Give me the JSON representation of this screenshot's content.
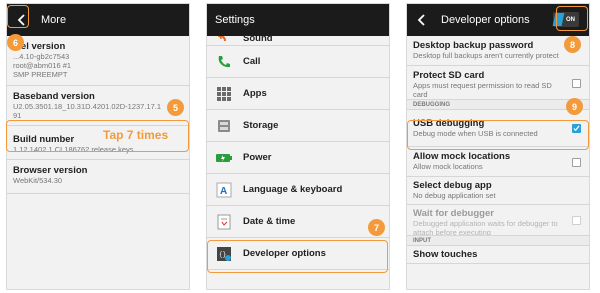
{
  "panel1": {
    "title": "More",
    "items": [
      {
        "title": "...el version",
        "sub": [
          "...4.10-gb2c7543",
          "root@abm016 #1",
          "SMP PREEMPT"
        ]
      },
      {
        "title": "Baseband version",
        "sub": [
          "U2.05.3501.18_10.31D.4201.02D-1237.17.1",
          "91"
        ]
      },
      {
        "title": "Build number",
        "sub": [
          "1.12.1402.1 CL186762 release keys"
        ]
      },
      {
        "title": "Browser version",
        "sub": [
          "WebKit/534.30"
        ]
      }
    ],
    "tap_text": "Tap 7 times"
  },
  "panel2": {
    "title": "Settings",
    "items": [
      {
        "label": "Sound",
        "icon": "sound-icon"
      },
      {
        "label": "Call",
        "icon": "phone-icon"
      },
      {
        "label": "Apps",
        "icon": "apps-grid-icon"
      },
      {
        "label": "Storage",
        "icon": "storage-icon"
      },
      {
        "label": "Power",
        "icon": "battery-icon"
      },
      {
        "label": "Language & keyboard",
        "icon": "language-icon"
      },
      {
        "label": "Date & time",
        "icon": "clock-icon"
      },
      {
        "label": "Developer options",
        "icon": "developer-icon"
      }
    ]
  },
  "panel3": {
    "title": "Developer options",
    "toggle_label": "ON",
    "sections": {
      "debugging": "DEBUGGING",
      "input": "INPUT"
    },
    "items": [
      {
        "title": "Desktop backup password",
        "sub": [
          "Desktop full backups aren't currently protect"
        ]
      },
      {
        "title": "Protect SD card",
        "sub": [
          "Apps must request permission to read SD",
          "card"
        ]
      },
      {
        "title": "USB debugging",
        "sub": [
          "Debug mode when USB is connected"
        ]
      },
      {
        "title": "Allow mock locations",
        "sub": [
          "Allow mock locations"
        ]
      },
      {
        "title": "Select debug app",
        "sub": [
          "No debug application set"
        ]
      },
      {
        "title": "Wait for debugger",
        "sub": [
          "Debugged application waits for debugger to",
          "attach before executing"
        ]
      },
      {
        "title": "Show touches",
        "sub": []
      }
    ]
  },
  "badges": [
    "6",
    "5",
    "7",
    "8",
    "9"
  ],
  "colors": {
    "accent": "#f39a3c",
    "check": "#2aa0d8",
    "topbar": "#1b1b1b"
  }
}
